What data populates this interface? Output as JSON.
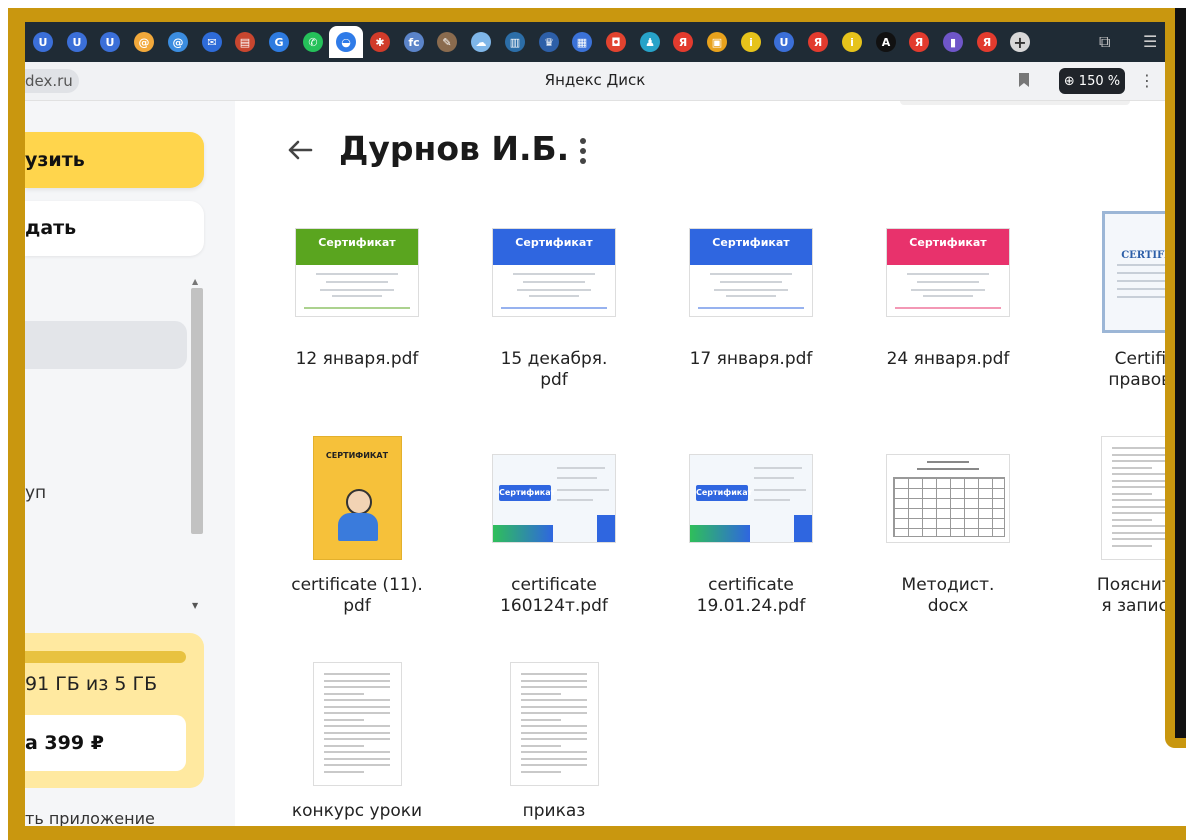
{
  "browser": {
    "address_chip": "dex.ru",
    "page_title": "Яндекс Диск",
    "zoom": "150 %"
  },
  "tabs": [
    {
      "icon": "yandex-u-icon",
      "glyph": "U",
      "color": "#3b6fd8"
    },
    {
      "icon": "yandex-u-icon",
      "glyph": "U",
      "color": "#3b6fd8"
    },
    {
      "icon": "yandex-u-icon",
      "glyph": "U",
      "color": "#3b6fd8"
    },
    {
      "icon": "mail-at-icon",
      "glyph": "@",
      "color": "#f2a93b"
    },
    {
      "icon": "mail-at-icon",
      "glyph": "@",
      "color": "#3b8de0"
    },
    {
      "icon": "mail-envelope-icon",
      "glyph": "✉",
      "color": "#2e6bd8"
    },
    {
      "icon": "book-icon",
      "glyph": "▤",
      "color": "#c8462f"
    },
    {
      "icon": "google-icon",
      "glyph": "G",
      "color": "#2e7be0"
    },
    {
      "icon": "whatsapp-icon",
      "glyph": "✆",
      "color": "#25c15a"
    },
    {
      "icon": "cloud-disk-icon",
      "glyph": "◒",
      "color": "#2f7be8"
    },
    {
      "icon": "star-icon",
      "glyph": "✱",
      "color": "#d13b2a"
    },
    {
      "icon": "fcs-icon",
      "glyph": "fc",
      "color": "#5b84c9"
    },
    {
      "icon": "pen-icon",
      "glyph": "✎",
      "color": "#8a6b4e"
    },
    {
      "icon": "cloud-icon",
      "glyph": "☁",
      "color": "#7fb6e8"
    },
    {
      "icon": "book-open-icon",
      "glyph": "▥",
      "color": "#2c6ea8"
    },
    {
      "icon": "emblem-icon",
      "glyph": "♛",
      "color": "#2d5fa8"
    },
    {
      "icon": "files-icon",
      "glyph": "▦",
      "color": "#3b72d8"
    },
    {
      "icon": "bag-icon",
      "glyph": "◘",
      "color": "#e2432f"
    },
    {
      "icon": "person-icon",
      "glyph": "♟",
      "color": "#27a3c9"
    },
    {
      "icon": "yandex-ya-icon",
      "glyph": "Я",
      "color": "#e23b2e"
    },
    {
      "icon": "image-icon",
      "glyph": "▣",
      "color": "#e8a21c"
    },
    {
      "icon": "info-i-icon",
      "glyph": "i",
      "color": "#e6c31b"
    },
    {
      "icon": "yandex-u-icon",
      "glyph": "U",
      "color": "#3b6fd8"
    },
    {
      "icon": "yandex-ya-icon",
      "glyph": "Я",
      "color": "#e23b2e"
    },
    {
      "icon": "info-i-icon",
      "glyph": "i",
      "color": "#e6c31b"
    },
    {
      "icon": "letter-a-icon",
      "glyph": "A",
      "color": "#111111"
    },
    {
      "icon": "yandex-ya-icon",
      "glyph": "Я",
      "color": "#e23b2e"
    },
    {
      "icon": "bar-chart-icon",
      "glyph": "▮",
      "color": "#6f56c9"
    },
    {
      "icon": "yandex-ya-icon",
      "glyph": "Я",
      "color": "#e23b2e"
    }
  ],
  "sidebar": {
    "upload_label": "узить",
    "create_label": "дать",
    "nav_label": "уп",
    "storage_text": "91 ГБ из 5 ГБ",
    "buy_label": "а 399 ₽",
    "app_link": "ть приложение",
    "storage_fraction": 0.98
  },
  "folder": {
    "title": "Дурнов И.Б."
  },
  "files": [
    {
      "name": "12 января.pdf",
      "kind": "cert",
      "band_color": "#5aa51f",
      "band_title": "Сертификат"
    },
    {
      "name": "15 декабря.\npdf",
      "kind": "cert",
      "band_color": "#2f66e0",
      "band_title": "Сертификат"
    },
    {
      "name": "17 января.pdf",
      "kind": "cert",
      "band_color": "#2f66e0",
      "band_title": "Сертификат"
    },
    {
      "name": "24 января.pdf",
      "kind": "cert",
      "band_color": "#e8326c",
      "band_title": "Сертификат"
    },
    {
      "name": "Certific\nправово",
      "kind": "doc-cert",
      "band_title": "CERTIFI"
    },
    {
      "name": "certificate (11).\npdf",
      "kind": "poster",
      "band_title": "СЕРТИФИКАТ"
    },
    {
      "name": "certificate\n160124т.pdf",
      "kind": "cert2",
      "band_title": "Сертификат"
    },
    {
      "name": "certificate\n19.01.24.pdf",
      "kind": "cert3",
      "band_title": "Сертификат"
    },
    {
      "name": "Методист.\ndocx",
      "kind": "table-doc"
    },
    {
      "name": "Пояснител\nя записка",
      "kind": "doc"
    },
    {
      "name": "конкурс уроки",
      "kind": "doc"
    },
    {
      "name": "приказ",
      "kind": "doc"
    }
  ]
}
